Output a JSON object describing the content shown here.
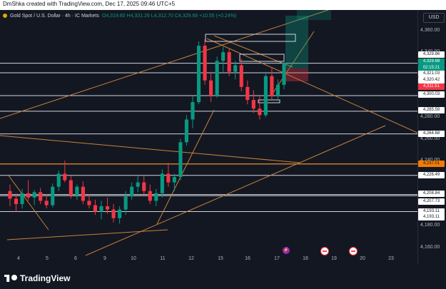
{
  "header": {
    "attribution": "DmShka created with TradingView.com, Dec 17, 2025 09:46 UTC+5"
  },
  "symbol": {
    "name": "Gold Spot / U.S. Dollar · 4h · IC Markets",
    "ohlc": "O4,319.60  H4,331.26  L4,312.70  C4,329.68  +10.55 (+0.24%)"
  },
  "price_axis": {
    "currency": "USD",
    "labels": [
      "4,360.00",
      "4,340.00",
      "4,280.00",
      "4,260.00",
      "4,240.00",
      "4,180.00",
      "4,160.00"
    ],
    "tags": [
      {
        "text": "4,329.86",
        "color": "#131722",
        "bg": "#ffffff"
      },
      {
        "text": "4,329.68",
        "color": "#ffffff",
        "bg": "#089981"
      },
      {
        "text": "02:15:21",
        "color": "#ffffff",
        "bg": "#089981"
      },
      {
        "text": "4,321.03",
        "color": "#131722",
        "bg": "#ffffff"
      },
      {
        "text": "4,320.42",
        "color": "#131722",
        "bg": "#ffffff"
      },
      {
        "text": "4,311.51",
        "color": "#ffffff",
        "bg": "#f23645"
      },
      {
        "text": "4,300.03",
        "color": "#131722",
        "bg": "#ffffff"
      },
      {
        "text": "4,285.59",
        "color": "#131722",
        "bg": "#ffffff"
      },
      {
        "text": "4,264.68",
        "color": "#131722",
        "bg": "#ffffff"
      },
      {
        "text": "4,237.01",
        "color": "#131722",
        "bg": "#f57c00"
      },
      {
        "text": "4,226.49",
        "color": "#131722",
        "bg": "#ffffff"
      },
      {
        "text": "4,208.84",
        "color": "#131722",
        "bg": "#ffffff"
      },
      {
        "text": "4,207.73",
        "color": "#131722",
        "bg": "#ffffff"
      },
      {
        "text": "4,193.11",
        "color": "#131722",
        "bg": "#ffffff"
      },
      {
        "text": "4,193.11",
        "color": "#131722",
        "bg": "#ffffff"
      }
    ]
  },
  "time_axis": {
    "labels": [
      "4",
      "5",
      "6",
      "9",
      "10",
      "11",
      "12",
      "15",
      "16",
      "17",
      "18",
      "19",
      "20",
      "23"
    ]
  },
  "chart_data": {
    "type": "candlestick",
    "title": "Gold Spot / U.S. Dollar · 4h · IC Markets",
    "xlabel": "",
    "ylabel": "",
    "ylim": [
      4150,
      4375
    ],
    "candles": [
      [
        4212,
        4218,
        4198,
        4205
      ],
      [
        4205,
        4210,
        4193,
        4200
      ],
      [
        4200,
        4214,
        4196,
        4210
      ],
      [
        4210,
        4222,
        4203,
        4206
      ],
      [
        4206,
        4213,
        4199,
        4211
      ],
      [
        4211,
        4215,
        4200,
        4203
      ],
      [
        4203,
        4209,
        4196,
        4199
      ],
      [
        4199,
        4219,
        4197,
        4216
      ],
      [
        4216,
        4231,
        4212,
        4228
      ],
      [
        4228,
        4240,
        4220,
        4222
      ],
      [
        4222,
        4226,
        4205,
        4208
      ],
      [
        4208,
        4218,
        4204,
        4216
      ],
      [
        4216,
        4221,
        4200,
        4203
      ],
      [
        4203,
        4209,
        4196,
        4199
      ],
      [
        4199,
        4204,
        4190,
        4193
      ],
      [
        4193,
        4203,
        4186,
        4198
      ],
      [
        4198,
        4206,
        4191,
        4195
      ],
      [
        4195,
        4200,
        4183,
        4187
      ],
      [
        4187,
        4198,
        4182,
        4195
      ],
      [
        4195,
        4212,
        4190,
        4207
      ],
      [
        4207,
        4220,
        4204,
        4216
      ],
      [
        4216,
        4226,
        4211,
        4220
      ],
      [
        4220,
        4226,
        4209,
        4212
      ],
      [
        4212,
        4218,
        4200,
        4203
      ],
      [
        4203,
        4214,
        4198,
        4210
      ],
      [
        4210,
        4232,
        4206,
        4228
      ],
      [
        4228,
        4238,
        4216,
        4220
      ],
      [
        4220,
        4228,
        4212,
        4225
      ],
      [
        4225,
        4260,
        4222,
        4257
      ],
      [
        4257,
        4282,
        4254,
        4278
      ],
      [
        4278,
        4300,
        4270,
        4294
      ],
      [
        4294,
        4350,
        4292,
        4346
      ],
      [
        4346,
        4352,
        4310,
        4314
      ],
      [
        4314,
        4322,
        4294,
        4300
      ],
      [
        4300,
        4336,
        4298,
        4332
      ],
      [
        4332,
        4345,
        4322,
        4340
      ],
      [
        4340,
        4343,
        4318,
        4322
      ],
      [
        4322,
        4332,
        4315,
        4328
      ],
      [
        4328,
        4334,
        4304,
        4308
      ],
      [
        4308,
        4314,
        4292,
        4296
      ],
      [
        4296,
        4305,
        4284,
        4288
      ],
      [
        4288,
        4300,
        4278,
        4282
      ],
      [
        4282,
        4322,
        4280,
        4318
      ],
      [
        4318,
        4326,
        4296,
        4300
      ],
      [
        4300,
        4315,
        4296,
        4310
      ],
      [
        4310,
        4331,
        4306,
        4330
      ]
    ],
    "hlines": [
      4329.86,
      4321.03,
      4300.03,
      4285.59,
      4264.68,
      4237.01,
      4226.49,
      4208.84,
      4207.73,
      4193.11
    ],
    "grid": false,
    "legend": "none"
  }
}
